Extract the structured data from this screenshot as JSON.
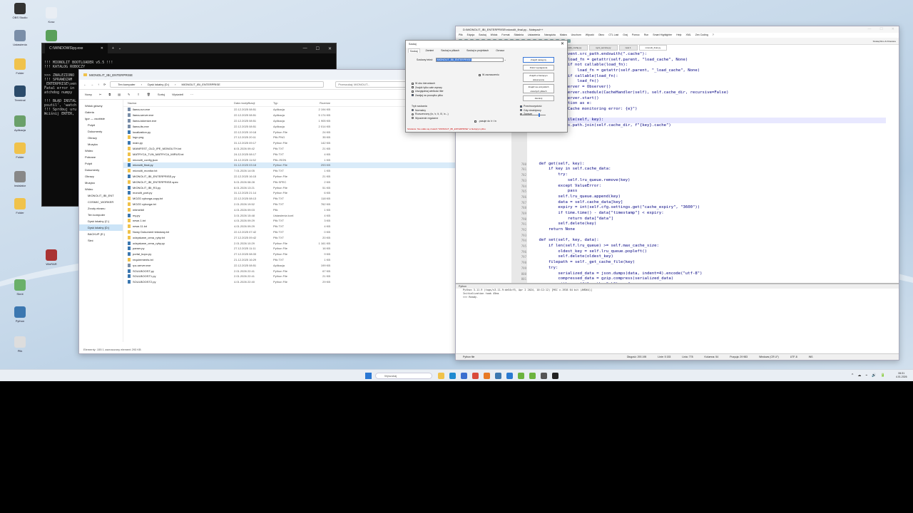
{
  "desktop": {
    "icons": [
      {
        "label": "OBS Studio",
        "color": "#333"
      },
      {
        "label": "Kosz",
        "color": "#e9eef4"
      },
      {
        "label": "Ustawienia",
        "color": "#7a8ea8"
      },
      {
        "label": "Edytor",
        "color": "#5aa05a"
      },
      {
        "label": "Folder",
        "color": "#f0c24b"
      },
      {
        "label": "Terminal",
        "color": "#2b4b6b"
      },
      {
        "label": "Aplikacja",
        "color": "#6aa06a"
      },
      {
        "label": "Skrót",
        "color": "#4d8a4d"
      },
      {
        "label": "Folder",
        "color": "#f0c24b"
      },
      {
        "label": "Instalator",
        "color": "#888"
      },
      {
        "label": "Folder",
        "color": "#f0c24b"
      },
      {
        "label": "WinRAR",
        "color": "#a33"
      },
      {
        "label": "Skrót",
        "color": "#6ab06a"
      },
      {
        "label": "Python",
        "color": "#3b77b0"
      },
      {
        "label": "Plik",
        "color": "#ddd"
      }
    ]
  },
  "terminal": {
    "tab_title": "C:\\WINDOWS\\py.exe",
    "lines": [
      "!!! MIONOLIT BOOTLOADER v5.5 !!!",
      "!!! KATALOG ROBOCZY",
      "",
      ">>> ZNALEZIONO",
      "!!! SPRAWDZAM",
      "_ENTERPRISE\\ven",
      "Fatal error in",
      "atchdog numpy",
      "",
      "!!! BŁĄD INSTAL",
      "psutil', 'watch",
      "!!! Spróbuj uru",
      "Wciśnij ENTER,"
    ]
  },
  "explorer": {
    "title": "MIONOLIT_IBI_ENTERPRISE",
    "breadcrumb": [
      "Ten komputer",
      "Dysk lokalny (D:)",
      "MIONOLIT_IBI_ENTERPRISE"
    ],
    "search_placeholder": "Przeszukaj: MIONOLIT...",
    "toolbar": {
      "new": "Nowy",
      "sort": "Sortuj",
      "view": "Wyświetl"
    },
    "columns": [
      "Nazwa",
      "Data modyfikacji",
      "Typ",
      "Rozmiar"
    ],
    "sidebar": [
      "Widok główny",
      "Galeria",
      "Igor — osobiste",
      "Pulpit",
      "Dokumenty",
      "Obrazy",
      "Muzyka",
      "Wideo",
      "Pobrane",
      "Pulpit",
      "Dokumenty",
      "Obrazy",
      "Muzyka",
      "Wideo",
      "MIONOLIT_IBI_ENT",
      "COSMIC_WORKER",
      "Zrzuty ekranu",
      "Ten komputer",
      "Dysk lokalny (C:)",
      "Dysk lokalny (D:)",
      "BACKUP (E:)",
      "Sieć"
    ],
    "files": [
      {
        "name": "llama-run.exe",
        "date": "22.12.2025 08:51",
        "type": "Aplikacja",
        "size": "2 194 KB",
        "kind": "exe"
      },
      {
        "name": "llama-server.exe",
        "date": "22.12.2025 08:51",
        "type": "Aplikacja",
        "size": "5 174 KB",
        "kind": "exe"
      },
      {
        "name": "llama-tokenize.exe",
        "date": "22.12.2025 08:51",
        "type": "Aplikacja",
        "size": "1 905 KB",
        "kind": "exe"
      },
      {
        "name": "llama-tts.exe",
        "date": "22.12.2025 08:51",
        "type": "Aplikacja",
        "size": "2 014 KB",
        "kind": "exe"
      },
      {
        "name": "localization.py",
        "date": "22.12.2025 19:18",
        "type": "Python File",
        "size": "24 KB",
        "kind": "py"
      },
      {
        "name": "logo.png",
        "date": "27.12.2025 20:11",
        "type": "Plik PNG",
        "size": "35 KB",
        "kind": ""
      },
      {
        "name": "main.py",
        "date": "31.12.2025 09:17",
        "type": "Python File",
        "size": "142 KB",
        "kind": "py"
      },
      {
        "name": "MANIFEST_OLD_IPE_MONOLITH.txt",
        "date": "8.01.2026 09:42",
        "type": "Plik TXT",
        "size": "21 KB",
        "kind": ""
      },
      {
        "name": "MATRYCA_TUN_MATRYCA_MIRUS.txt",
        "date": "24.12.2025 08:17",
        "type": "Plik TXT",
        "size": "4 KB",
        "kind": ""
      },
      {
        "name": "mionolit_config.json",
        "date": "24.12.2025 11:52",
        "type": "Plik JSON",
        "size": "1 KB",
        "kind": ""
      },
      {
        "name": "mionolit_final.py",
        "date": "31.12.2025 03:18",
        "type": "Python File",
        "size": "293 KB",
        "kind": "py"
      },
      {
        "name": "mionolit_monitor.txt",
        "date": "7.01.2026 14:05",
        "type": "Plik TXT",
        "size": "1 KB",
        "kind": ""
      },
      {
        "name": "MIONOLIT_IBI_ENTERPRISE.py",
        "date": "22.12.2025 16:15",
        "type": "Python File",
        "size": "21 KB",
        "kind": "py"
      },
      {
        "name": "MIONOLIT_IBI_ENTERPRISE.spec",
        "date": "5.01.2026 08:28",
        "type": "Plik SPEC",
        "size": "2 KB",
        "kind": ""
      },
      {
        "name": "MIONOLIT_IBI_R3.py",
        "date": "8.01.2026 13:21",
        "type": "Python File",
        "size": "51 KB",
        "kind": "py"
      },
      {
        "name": "monolit_part.py",
        "date": "31.12.2025 21:14",
        "type": "Python File",
        "size": "6 KB",
        "kind": "py"
      },
      {
        "name": "MOZG cyborga-copy.txt",
        "date": "22.12.2025 08:13",
        "type": "Plik TXT",
        "size": "118 KB",
        "kind": ""
      },
      {
        "name": "MOZG cyborga.txt",
        "date": "2.01.2026 19:52",
        "type": "Plik TXT",
        "size": "762 KB",
        "kind": ""
      },
      {
        "name": "mtimelidl",
        "date": "4.01.2026 09:03",
        "type": "Plik",
        "size": "1 KB",
        "kind": ""
      },
      {
        "name": "my.py",
        "date": "3.01.2026 15:48",
        "type": "Ustawienia konf.",
        "size": "4 KB",
        "kind": "py"
      },
      {
        "name": "news 1.txt",
        "date": "4.01.2026 09:29",
        "type": "Plik TXT",
        "size": "3 KB",
        "kind": ""
      },
      {
        "name": "news 11.txt",
        "date": "4.01.2026 09:29",
        "type": "Plik TXT",
        "size": "4 KB",
        "kind": ""
      },
      {
        "name": "Nowy Dokument tekstowy.txt",
        "date": "22.12.2025 07:42",
        "type": "Plik TXT",
        "size": "0 KB",
        "kind": ""
      },
      {
        "name": "odzyskane_cena_ryby.txt",
        "date": "27.12.2025 09:42",
        "type": "Plik TXT",
        "size": "20 KB",
        "kind": ""
      },
      {
        "name": "odzyskane_cena_ryby.py",
        "date": "2.01.2026 10:29",
        "type": "Python File",
        "size": "1 161 KB",
        "kind": "py"
      },
      {
        "name": "parser.py",
        "date": "27.12.2025 11:11",
        "type": "Python File",
        "size": "16 KB",
        "kind": "py"
      },
      {
        "name": "portal_kupo.py",
        "date": "27.12.2025 08:33",
        "type": "Python File",
        "size": "9 KB",
        "kind": "py"
      },
      {
        "name": "requirements.txt",
        "date": "21.12.2025 16:29",
        "type": "Plik TXT",
        "size": "1 KB",
        "kind": ""
      },
      {
        "name": "rpc-server.exe",
        "date": "22.12.2025 08:51",
        "type": "Aplikacja",
        "size": "199 KB",
        "kind": "exe"
      },
      {
        "name": "SOULBOOST.py",
        "date": "2.01.2026 22:41",
        "type": "Python File",
        "size": "67 KB",
        "kind": "py"
      },
      {
        "name": "SOULBOOST1.py",
        "date": "2.01.2026 22:41",
        "type": "Python File",
        "size": "21 KB",
        "kind": "py"
      },
      {
        "name": "SOULBOOST2.py",
        "date": "4.01.2026 22:40",
        "type": "Python File",
        "size": "29 KB",
        "kind": "py"
      }
    ],
    "status": "Elementy: 155    1 zaznaczony element   293 KB"
  },
  "dialog": {
    "title": "Szukaj",
    "tabs": [
      "Szukaj",
      "Zamień",
      "Szukaj w plikach",
      "Szukaj w projektach",
      "Oznacz"
    ],
    "find_label": "Szukany tekst:",
    "find_value": "MIONOLIT_IBI_ENTERPRISE",
    "buttons": [
      "Znajdź następny",
      "Policz wystąpienia",
      "Znajdź w bieżącym dokumencie",
      "Znajdź we wszystkich otwartych plikach",
      "Zamknij"
    ],
    "in_selection": "W zaznaczeniu",
    "options": [
      "W obu kierunkach",
      "Znajdź tylko całe wyrazy",
      "Uwzględniaj wielkość liter",
      "Zawijaj na początku pliku"
    ],
    "mode_title": "Tryb szukania",
    "modes": [
      "Normalny",
      "Rozszerzony (\\n, \\r, \\t, \\0, \\x...)",
      "Wyrażenie regularne"
    ],
    "dot_nl": ". pasuje do \\r i \\n",
    "transp_title": "Przeźroczystość",
    "transp_opts": [
      "Gdy nieaktywny",
      "Zawsze"
    ],
    "status": "Szukanie: Nie udało się znaleźć \"MIONOLIT_IBI_ENTERPRISE\" w bieżącym pliku."
  },
  "notepad": {
    "title": "D:\\MIONOLIT_IBI_ENTERPRISE\\mionolit_final.py - Notepad++",
    "menu": [
      "Plik",
      "Edycja",
      "Szukaj",
      "Widok",
      "Format",
      "Składnia",
      "Ustawienia",
      "Narzędzia",
      "Makra",
      "Uruchom",
      "Wtyczki",
      "Okno",
      "CTL Last",
      "Graj",
      "Pomoc",
      "Run",
      "Smart Highlighter",
      "Help",
      "XML",
      "Zen Coding",
      "?"
    ],
    "tabs": [
      "watchdog_monitor_advanced.py",
      "mionolit_config.py",
      "sync_service.py",
      "new 1",
      "mionolit_final.py"
    ],
    "search_hint": "Szukaj filmu & Polecane",
    "line_numbers": [
      "",
      "",
      "",
      "",
      "",
      "",
      "",
      "",
      "",
      "",
      "",
      "",
      "",
      "",
      "",
      "",
      "",
      "",
      "",
      "",
      "780",
      "781",
      "782",
      "783",
      "784",
      "785",
      "786",
      "787",
      "788",
      "789",
      "790",
      "791",
      "792",
      "793",
      "794",
      "795",
      "796",
      "797",
      "798",
      "799",
      "800",
      "801",
      "802",
      "803",
      "804"
    ],
    "code": [
      "            if event.src_path.endswith(\".cache\"):",
      "                load_fn = getattr(self.parent, \"load_cache\", None)",
      "                if not callable(load_fn):",
      "                    load_fn = getattr(self.parent, \"_load_cache\", None)",
      "                if callable(load_fn):",
      "                    load_fn()",
      "        self.observer = Observer()",
      "        self.observer.schedule(CacheHandler(self), self.cache_dir, recursive=False)",
      "        self.observer.start()",
      "    except Exception as e:",
      "        print(f\"Cache monitoring error: {e}\")",
      "",
      "    def _cache_file(self, key):",
      "        return os.path.join(self.cache_dir, f\"{key}.cache\")",
      "",
      "",
      "",
      "",
      "",
      "",
      "    def get(self, key):",
      "        if key in self.cache_data:",
      "            try:",
      "                self.lru_queue.remove(key)",
      "            except ValueError:",
      "                pass",
      "            self.lru_queue.append(key)",
      "            data = self.cache_data[key]",
      "            expiry = int(self.cfg.settings.get(\"cache_expiry\", \"3600\"))",
      "            if time.time() - data[\"timestamp\"] < expiry:",
      "                return data[\"data\"]",
      "            self.delete(key)",
      "        return None",
      "",
      "    def set(self, key, data):",
      "        if len(self.lru_queue) >= self.max_cache_size:",
      "            oldest_key = self.lru_queue.popleft()",
      "            self.delete(oldest_key)",
      "        filepath = self._get_cache_file(key)",
      "        try:",
      "            serialized_data = json.dumps(data, indent=4).encode(\"utf-8\")",
      "            compressed_data = gzip.compress(serialized_data)",
      "            with open(filepath, \"wb\") as f:",
      "                f.write(compressed_data)",
      "            self.cache_data[key] = {\"data\": data, \"timestamp\": time.time()}",
      "            self.lru_queue.append(key)"
    ],
    "console_title": "Python",
    "console_lines": [
      "Python 3.11.9 (tags/v3.11.9:de54cf5, Apr  2 2024, 10:12:12) [MSC v.1938 64 bit (AMD64)]",
      "Initialization took 45ms",
      ">>> Ready."
    ],
    "status": [
      "Python file",
      "Długość: 293 195",
      "Linie: 5 153",
      "Linia: 778",
      "Kolumna: 54",
      "Pozycja: 29 983",
      "Windows (CR LF)",
      "UTF-8",
      "INS"
    ]
  },
  "taskbar": {
    "search_placeholder": "Wyszukaj",
    "time": "06:31",
    "date": "4.01.2026",
    "apps": [
      {
        "name": "explorer",
        "color": "#f0c24b"
      },
      {
        "name": "edge",
        "color": "#1f8ad1"
      },
      {
        "name": "store",
        "color": "#3b6fcf"
      },
      {
        "name": "chrome",
        "color": "#d94b3b"
      },
      {
        "name": "firefox",
        "color": "#e77a26"
      },
      {
        "name": "python",
        "color": "#3b77b0"
      },
      {
        "name": "vscode",
        "color": "#2a7ad1"
      },
      {
        "name": "notepadpp",
        "color": "#6cb33f"
      },
      {
        "name": "mionolit",
        "color": "#6cb33f"
      },
      {
        "name": "settings",
        "color": "#555"
      },
      {
        "name": "terminal",
        "color": "#222"
      }
    ],
    "tray": [
      "^",
      "☁",
      "⌁",
      "🔊",
      "🔋"
    ]
  }
}
